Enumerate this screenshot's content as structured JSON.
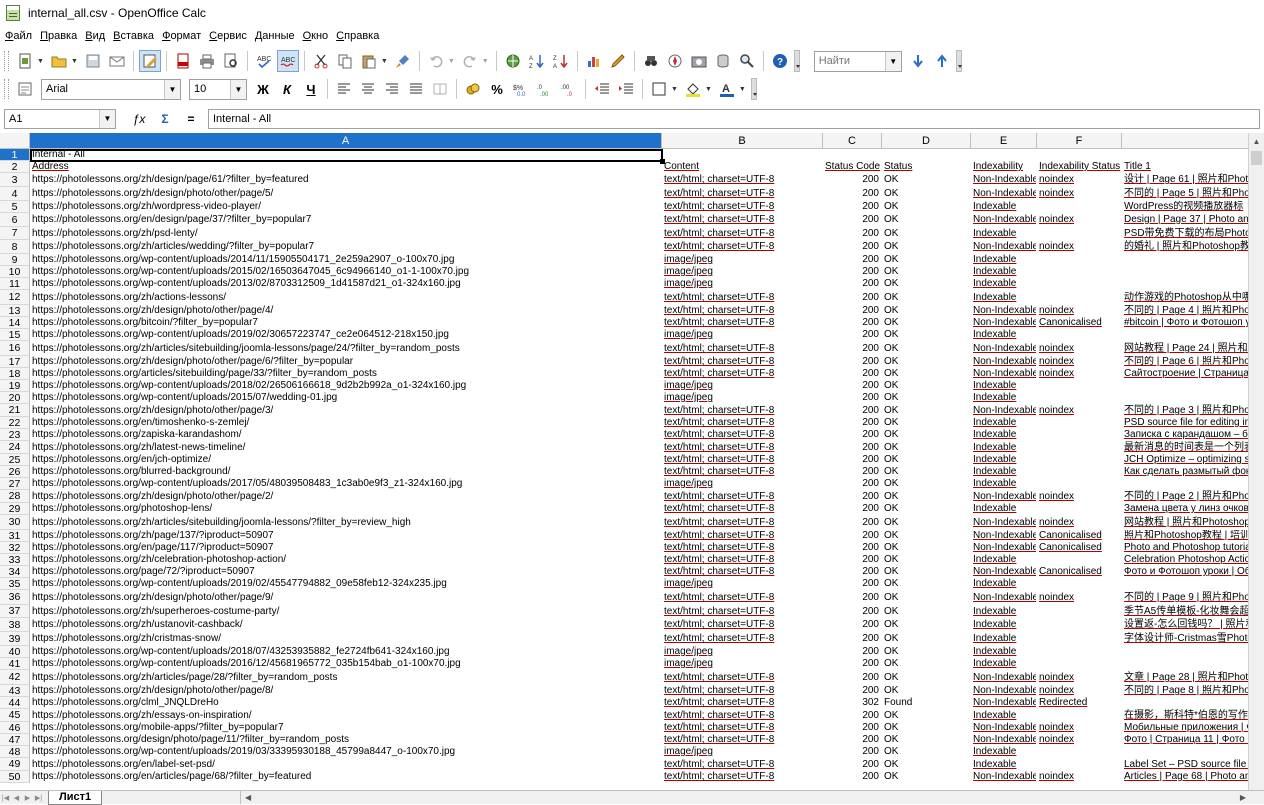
{
  "window": {
    "title": "internal_all.csv - OpenOffice Calc"
  },
  "menu": [
    "Файл",
    "Правка",
    "Вид",
    "Вставка",
    "Формат",
    "Сервис",
    "Данные",
    "Окно",
    "Справка"
  ],
  "toolbar1": {
    "find_placeholder": "Найти",
    "icons": [
      "new-document-icon",
      "open-folder-icon",
      "save-icon",
      "email-icon",
      "edit-mode-icon",
      "export-pdf-icon",
      "print-icon",
      "print-preview-icon",
      "spellcheck-icon",
      "autospellcheck-icon",
      "cut-icon",
      "copy-icon",
      "paste-icon",
      "format-paintbrush-icon",
      "undo-icon",
      "redo-icon",
      "hyperlink-icon",
      "sort-ascending-icon",
      "sort-descending-icon",
      "insert-chart-icon",
      "show-draw-icon",
      "find-replace-icon",
      "navigator-icon",
      "gallery-icon",
      "data-sources-icon",
      "zoom-icon",
      "help-icon"
    ]
  },
  "toolbar2": {
    "font_name": "Arial",
    "font_size": "10",
    "bold": "Ж",
    "italic": "К",
    "underline": "Ч"
  },
  "formula_bar": {
    "name_box": "A1",
    "function_wizard": "ƒx",
    "sum": "Σ",
    "equals": "=",
    "content": "Internal - All"
  },
  "columns": [
    "A",
    "B",
    "C",
    "D",
    "E",
    "F",
    ""
  ],
  "rows": [
    {
      "n": "1",
      "a": "Internal - All",
      "b": "",
      "c": "",
      "d": "",
      "e": "",
      "f": "",
      "g": ""
    },
    {
      "n": "2",
      "a": "Address",
      "b": "Content",
      "c": "Status Code",
      "d": "Status",
      "e": "Indexability",
      "f": "Indexability Status",
      "g": "Title 1"
    },
    {
      "n": "3",
      "a": "https://photolessons.org/zh/design/page/61/?filter_by=featured",
      "b": "text/html; charset=UTF-8",
      "c": "200",
      "d": "OK",
      "e": "Non-Indexable",
      "f": "noindex",
      "g": "设计 | Page 61 | 照片和Photo"
    },
    {
      "n": "4",
      "a": "https://photolessons.org/zh/design/photo/other/page/5/",
      "b": "text/html; charset=UTF-8",
      "c": "200",
      "d": "OK",
      "e": "Non-Indexable",
      "f": "noindex",
      "g": "不同的 | Page 5 | 照片和Phot"
    },
    {
      "n": "5",
      "a": "https://photolessons.org/zh/wordpress-video-player/",
      "b": "text/html; charset=UTF-8",
      "c": "200",
      "d": "OK",
      "e": "Indexable",
      "f": "",
      "g": "WordPress的视频播放器标"
    },
    {
      "n": "6",
      "a": "https://photolessons.org/en/design/page/37/?filter_by=popular7",
      "b": "text/html; charset=UTF-8",
      "c": "200",
      "d": "OK",
      "e": "Non-Indexable",
      "f": "noindex",
      "g": "Design | Page 37 | Photo and"
    },
    {
      "n": "7",
      "a": "https://photolessons.org/zh/psd-lenty/",
      "b": "text/html; charset=UTF-8",
      "c": "200",
      "d": "OK",
      "e": "Indexable",
      "f": "",
      "g": "PSD带免费下载的布局Photos"
    },
    {
      "n": "8",
      "a": "https://photolessons.org/zh/articles/wedding/?filter_by=popular7",
      "b": "text/html; charset=UTF-8",
      "c": "200",
      "d": "OK",
      "e": "Non-Indexable",
      "f": "noindex",
      "g": "的婚礼 | 照片和Photoshop教"
    },
    {
      "n": "9",
      "a": "https://photolessons.org/wp-content/uploads/2014/11/15905504171_2e259a2907_o-100x70.jpg",
      "b": "image/jpeg",
      "c": "200",
      "d": "OK",
      "e": "Indexable",
      "f": "",
      "g": ""
    },
    {
      "n": "10",
      "a": "https://photolessons.org/wp-content/uploads/2015/02/16503647045_6c94966140_o1-1-100x70.jpg",
      "b": "image/jpeg",
      "c": "200",
      "d": "OK",
      "e": "Indexable",
      "f": "",
      "g": ""
    },
    {
      "n": "11",
      "a": "https://photolessons.org/wp-content/uploads/2013/02/8703312509_1d41587d21_o1-324x160.jpg",
      "b": "image/jpeg",
      "c": "200",
      "d": "OK",
      "e": "Indexable",
      "f": "",
      "g": ""
    },
    {
      "n": "12",
      "a": "https://photolessons.org/zh/actions-lessons/",
      "b": "text/html; charset=UTF-8",
      "c": "200",
      "d": "OK",
      "e": "Indexable",
      "f": "",
      "g": "动作游戏的Photoshop从中哪"
    },
    {
      "n": "13",
      "a": "https://photolessons.org/zh/design/photo/other/page/4/",
      "b": "text/html; charset=UTF-8",
      "c": "200",
      "d": "OK",
      "e": "Non-Indexable",
      "f": "noindex",
      "g": "不同的 | Page 4 | 照片和Phot"
    },
    {
      "n": "14",
      "a": "https://photolessons.org/bitcoin/?filter_by=popular7",
      "b": "text/html; charset=UTF-8",
      "c": "200",
      "d": "OK",
      "e": "Non-Indexable",
      "f": "Canonicalised",
      "g": "#bitcoin | Фото и Фотошоп у"
    },
    {
      "n": "15",
      "a": "https://photolessons.org/wp-content/uploads/2019/02/30657223747_ce2e064512-218x150.jpg",
      "b": "image/jpeg",
      "c": "200",
      "d": "OK",
      "e": "Indexable",
      "f": "",
      "g": ""
    },
    {
      "n": "16",
      "a": "https://photolessons.org/zh/articles/sitebuilding/joomla-lessons/page/24/?filter_by=random_posts",
      "b": "text/html; charset=UTF-8",
      "c": "200",
      "d": "OK",
      "e": "Non-Indexable",
      "f": "noindex",
      "g": "网站教程 | Page 24 | 照片和P"
    },
    {
      "n": "17",
      "a": "https://photolessons.org/zh/design/photo/other/page/6/?filter_by=popular",
      "b": "text/html; charset=UTF-8",
      "c": "200",
      "d": "OK",
      "e": "Non-Indexable",
      "f": "noindex",
      "g": "不同的 | Page 6 | 照片和Phot"
    },
    {
      "n": "18",
      "a": "https://photolessons.org/articles/sitebuilding/page/33/?filter_by=random_posts",
      "b": "text/html; charset=UTF-8",
      "c": "200",
      "d": "OK",
      "e": "Non-Indexable",
      "f": "noindex",
      "g": "Сайтостроение | Страница"
    },
    {
      "n": "19",
      "a": "https://photolessons.org/wp-content/uploads/2018/02/26506166618_9d2b2b992a_o1-324x160.jpg",
      "b": "image/jpeg",
      "c": "200",
      "d": "OK",
      "e": "Indexable",
      "f": "",
      "g": ""
    },
    {
      "n": "20",
      "a": "https://photolessons.org/wp-content/uploads/2015/07/wedding-01.jpg",
      "b": "image/jpeg",
      "c": "200",
      "d": "OK",
      "e": "Indexable",
      "f": "",
      "g": ""
    },
    {
      "n": "21",
      "a": "https://photolessons.org/zh/design/photo/other/page/3/",
      "b": "text/html; charset=UTF-8",
      "c": "200",
      "d": "OK",
      "e": "Non-Indexable",
      "f": "noindex",
      "g": "不同的 | Page 3 | 照片和Phot"
    },
    {
      "n": "22",
      "a": "https://photolessons.org/en/timoshenko-s-zemlej/",
      "b": "text/html; charset=UTF-8",
      "c": "200",
      "d": "OK",
      "e": "Indexable",
      "f": "",
      "g": "PSD source file for editing in"
    },
    {
      "n": "23",
      "a": "https://photolessons.org/zapiska-karandashom/",
      "b": "text/html; charset=UTF-8",
      "c": "200",
      "d": "OK",
      "e": "Indexable",
      "f": "",
      "g": "Записка с карандашом – бе"
    },
    {
      "n": "24",
      "a": "https://photolessons.org/zh/latest-news-timeline/",
      "b": "text/html; charset=UTF-8",
      "c": "200",
      "d": "OK",
      "e": "Indexable",
      "f": "",
      "g": "最新消息的时间表是一个列表"
    },
    {
      "n": "25",
      "a": "https://photolessons.org/en/jch-optimize/",
      "b": "text/html; charset=UTF-8",
      "c": "200",
      "d": "OK",
      "e": "Indexable",
      "f": "",
      "g": "JCH Optimize – optimizing sc"
    },
    {
      "n": "26",
      "a": "https://photolessons.org/blurred-background/",
      "b": "text/html; charset=UTF-8",
      "c": "200",
      "d": "OK",
      "e": "Indexable",
      "f": "",
      "g": "Как сделать размытый фон"
    },
    {
      "n": "27",
      "a": "https://photolessons.org/wp-content/uploads/2017/05/48039508483_1c3ab0e9f3_z1-324x160.jpg",
      "b": "image/jpeg",
      "c": "200",
      "d": "OK",
      "e": "Indexable",
      "f": "",
      "g": ""
    },
    {
      "n": "28",
      "a": "https://photolessons.org/zh/design/photo/other/page/2/",
      "b": "text/html; charset=UTF-8",
      "c": "200",
      "d": "OK",
      "e": "Non-Indexable",
      "f": "noindex",
      "g": "不同的 | Page 2 | 照片和Phot"
    },
    {
      "n": "29",
      "a": "https://photolessons.org/photoshop-lens/",
      "b": "text/html; charset=UTF-8",
      "c": "200",
      "d": "OK",
      "e": "Indexable",
      "f": "",
      "g": "Замена цвета у линз очков"
    },
    {
      "n": "30",
      "a": "https://photolessons.org/zh/articles/sitebuilding/joomla-lessons/?filter_by=review_high",
      "b": "text/html; charset=UTF-8",
      "c": "200",
      "d": "OK",
      "e": "Non-Indexable",
      "f": "noindex",
      "g": "网站教程 | 照片和Photoshop"
    },
    {
      "n": "31",
      "a": "https://photolessons.org/zh/page/137/?iproduct=50907",
      "b": "text/html; charset=UTF-8",
      "c": "200",
      "d": "OK",
      "e": "Non-Indexable",
      "f": "Canonicalised",
      "g": "照片和Photoshop教程 | 培训"
    },
    {
      "n": "32",
      "a": "https://photolessons.org/en/page/117/?iproduct=50907",
      "b": "text/html; charset=UTF-8",
      "c": "200",
      "d": "OK",
      "e": "Non-Indexable",
      "f": "Canonicalised",
      "g": "Photo and Photoshop tutorial"
    },
    {
      "n": "33",
      "a": "https://photolessons.org/zh/celebration-photoshop-action/",
      "b": "text/html; charset=UTF-8",
      "c": "200",
      "d": "OK",
      "e": "Indexable",
      "f": "",
      "g": "Celebration Photoshop Actio"
    },
    {
      "n": "34",
      "a": "https://photolessons.org/page/72/?iproduct=50907",
      "b": "text/html; charset=UTF-8",
      "c": "200",
      "d": "OK",
      "e": "Non-Indexable",
      "f": "Canonicalised",
      "g": "Фото и Фотошоп уроки | Об"
    },
    {
      "n": "35",
      "a": "https://photolessons.org/wp-content/uploads/2019/02/45547794882_09e58feb12-324x235.jpg",
      "b": "image/jpeg",
      "c": "200",
      "d": "OK",
      "e": "Indexable",
      "f": "",
      "g": ""
    },
    {
      "n": "36",
      "a": "https://photolessons.org/zh/design/photo/other/page/9/",
      "b": "text/html; charset=UTF-8",
      "c": "200",
      "d": "OK",
      "e": "Non-Indexable",
      "f": "noindex",
      "g": "不同的 | Page 9 | 照片和Phot"
    },
    {
      "n": "37",
      "a": "https://photolessons.org/zh/superheroes-costume-party/",
      "b": "text/html; charset=UTF-8",
      "c": "200",
      "d": "OK",
      "e": "Indexable",
      "f": "",
      "g": "季节A5传单模板-化妆舞会超"
    },
    {
      "n": "38",
      "a": "https://photolessons.org/zh/ustanovit-cashback/",
      "b": "text/html; charset=UTF-8",
      "c": "200",
      "d": "OK",
      "e": "Indexable",
      "f": "",
      "g": "设置返-怎么回钱吗？ | 照片和"
    },
    {
      "n": "39",
      "a": "https://photolessons.org/zh/cristmas-snow/",
      "b": "text/html; charset=UTF-8",
      "c": "200",
      "d": "OK",
      "e": "Indexable",
      "f": "",
      "g": "字体设计师-Cristmas雪Photc"
    },
    {
      "n": "40",
      "a": "https://photolessons.org/wp-content/uploads/2018/07/43253935882_fe2724fb641-324x160.jpg",
      "b": "image/jpeg",
      "c": "200",
      "d": "OK",
      "e": "Indexable",
      "f": "",
      "g": ""
    },
    {
      "n": "41",
      "a": "https://photolessons.org/wp-content/uploads/2016/12/45681965772_035b154bab_o1-100x70.jpg",
      "b": "image/jpeg",
      "c": "200",
      "d": "OK",
      "e": "Indexable",
      "f": "",
      "g": ""
    },
    {
      "n": "42",
      "a": "https://photolessons.org/zh/articles/page/28/?filter_by=random_posts",
      "b": "text/html; charset=UTF-8",
      "c": "200",
      "d": "OK",
      "e": "Non-Indexable",
      "f": "noindex",
      "g": "文章 | Page 28 | 照片和Photo"
    },
    {
      "n": "43",
      "a": "https://photolessons.org/zh/design/photo/other/page/8/",
      "b": "text/html; charset=UTF-8",
      "c": "200",
      "d": "OK",
      "e": "Non-Indexable",
      "f": "noindex",
      "g": "不同的 | Page 8 | 照片和Phot"
    },
    {
      "n": "44",
      "a": "https://photolessons.org/clml_JNQLDreHo",
      "b": "text/html; charset=UTF-8",
      "c": "302",
      "d": "Found",
      "e": "Non-Indexable",
      "f": "Redirected",
      "g": ""
    },
    {
      "n": "45",
      "a": "https://photolessons.org/zh/essays-on-inspiration/",
      "b": "text/html; charset=UTF-8",
      "c": "200",
      "d": "OK",
      "e": "Indexable",
      "f": "",
      "g": "在摄影，斯科特*伯恩的写作"
    },
    {
      "n": "46",
      "a": "https://photolessons.org/mobile-apps/?filter_by=popular7",
      "b": "text/html; charset=UTF-8",
      "c": "200",
      "d": "OK",
      "e": "Non-Indexable",
      "f": "noindex",
      "g": "Мобильные приложения | Ф"
    },
    {
      "n": "47",
      "a": "https://photolessons.org/design/photo/page/11/?filter_by=random_posts",
      "b": "text/html; charset=UTF-8",
      "c": "200",
      "d": "OK",
      "e": "Non-Indexable",
      "f": "noindex",
      "g": "Фото | Страница 11 | Фото и"
    },
    {
      "n": "48",
      "a": "https://photolessons.org/wp-content/uploads/2019/03/33395930188_45799a8447_o-100x70.jpg",
      "b": "image/jpeg",
      "c": "200",
      "d": "OK",
      "e": "Indexable",
      "f": "",
      "g": ""
    },
    {
      "n": "49",
      "a": "https://photolessons.org/en/label-set-psd/",
      "b": "text/html; charset=UTF-8",
      "c": "200",
      "d": "OK",
      "e": "Indexable",
      "f": "",
      "g": "Label Set – PSD source file c"
    },
    {
      "n": "50",
      "a": "https://photolessons.org/en/articles/page/68/?filter_by=featured",
      "b": "text/html; charset=UTF-8",
      "c": "200",
      "d": "OK",
      "e": "Non-Indexable",
      "f": "noindex",
      "g": "Articles | Page 68 | Photo anc"
    }
  ],
  "sheet_tabs": [
    "Лист1"
  ]
}
